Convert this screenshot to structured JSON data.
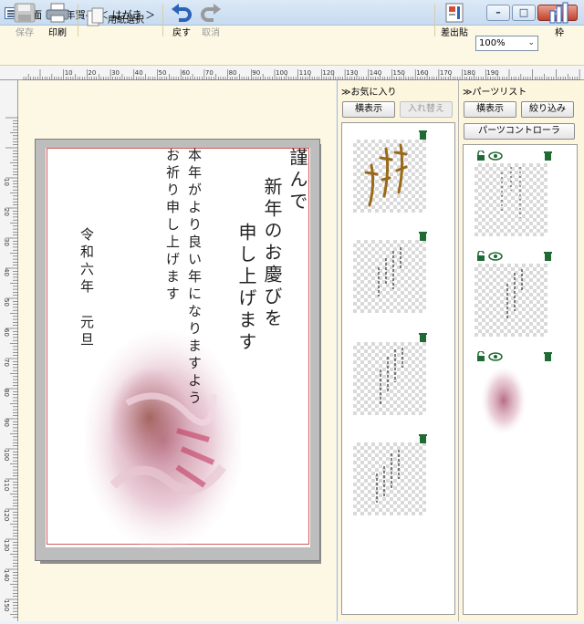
{
  "window": {
    "title": "文面　R6年賀-4 ＜ はがき ＞",
    "buttons": [
      "minimize",
      "maximize",
      "close"
    ]
  },
  "toolbar": {
    "save_label": "保存",
    "print_label": "印刷",
    "paper_label": "用紙選択",
    "undo_label": "戻す",
    "redo_label": "取消",
    "merge_label": "差出貼",
    "zoom_value": "100%",
    "frame_label": "枠"
  },
  "ruler": {
    "top_labels": [
      "10",
      "20",
      "30",
      "40",
      "50",
      "60",
      "70",
      "80",
      "90",
      "100",
      "110",
      "120",
      "130",
      "140",
      "150",
      "160",
      "170",
      "180",
      "190"
    ],
    "left_labels": [
      "10",
      "20",
      "30",
      "40",
      "50",
      "60",
      "70",
      "80",
      "90",
      "100",
      "110",
      "120",
      "130",
      "140",
      "150",
      "160"
    ]
  },
  "card": {
    "greeting_col1": "謹んで",
    "greeting_col2": "新年のお慶びを",
    "greeting_col3": "申し上げます",
    "body_col1": "本年がより良い年になりますよう",
    "body_col2": "お祈り申し上げます",
    "date_col1": "令和六年",
    "date_col2": "元旦"
  },
  "favorites": {
    "title": "≫お気に入り",
    "view_button": "横表示",
    "swap_button": "入れ替え"
  },
  "parts": {
    "title": "≫パーツリスト",
    "view_button": "横表示",
    "filter_button": "絞り込み",
    "controller_button": "パーツコントローラ"
  }
}
